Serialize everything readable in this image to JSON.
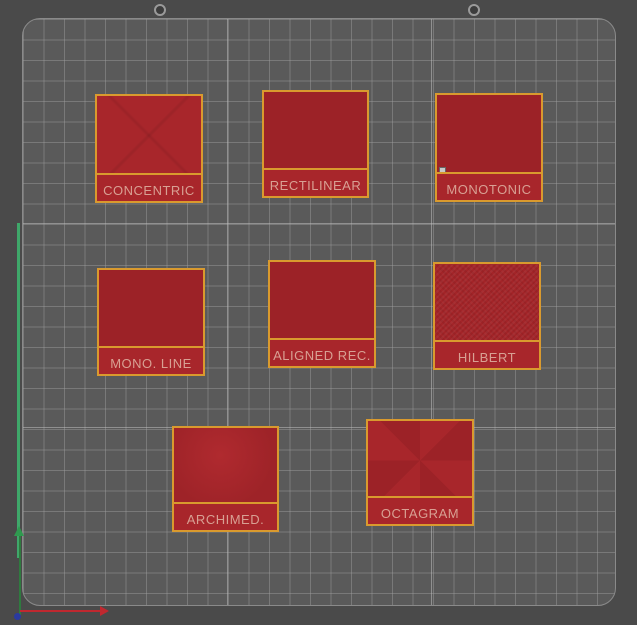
{
  "parts": [
    {
      "id": "concentric",
      "label": "CONCENTRIC"
    },
    {
      "id": "rectilinear",
      "label": "RECTILINEAR"
    },
    {
      "id": "monotonic",
      "label": "MONOTONIC"
    },
    {
      "id": "mono-line",
      "label": "MONO. LINE"
    },
    {
      "id": "aligned-rec",
      "label": "ALIGNED REC."
    },
    {
      "id": "hilbert",
      "label": "HILBERT"
    },
    {
      "id": "archimed",
      "label": "ARCHIMED."
    },
    {
      "id": "octagram",
      "label": "OCTAGRAM"
    }
  ],
  "colors": {
    "part_fill": "#a8262b",
    "part_outline": "#d99a2e",
    "plate": "#5a5a5a",
    "axis_x": "#c0282f",
    "axis_y": "#3fa86a"
  }
}
